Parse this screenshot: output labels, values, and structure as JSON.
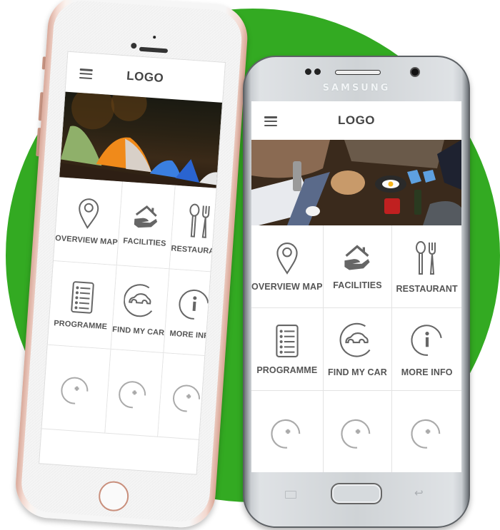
{
  "scene": {
    "background_color": "#ffffff",
    "accent_circle_color": "#33aa22"
  },
  "iphone": {
    "device": "iPhone (rose gold)",
    "app": {
      "header": {
        "logo": "LOGO",
        "menu_icon": "hamburger-menu-icon"
      },
      "hero_image": "camping-tents-at-night",
      "tiles": [
        {
          "label": "OVERVIEW MAP",
          "icon": "map-pin-icon"
        },
        {
          "label": "FACILITIES",
          "icon": "house-hand-icon"
        },
        {
          "label": "RESTAURANT",
          "icon": "spoon-fork-icon"
        },
        {
          "label": "PROGRAMME",
          "icon": "list-document-icon"
        },
        {
          "label": "FIND MY CAR",
          "icon": "car-circle-icon"
        },
        {
          "label": "MORE INFO",
          "icon": "info-circle-icon"
        },
        {
          "label": "",
          "icon": "add-circle-icon"
        },
        {
          "label": "",
          "icon": "add-circle-icon"
        },
        {
          "label": "",
          "icon": "add-circle-icon"
        }
      ]
    }
  },
  "samsung": {
    "device": "Samsung Galaxy (silver)",
    "brand": "SAMSUNG",
    "app": {
      "header": {
        "logo": "LOGO",
        "menu_icon": "hamburger-menu-icon"
      },
      "hero_image": "picnic-campfire-breakfast",
      "tiles": [
        {
          "label": "OVERVIEW MAP",
          "icon": "map-pin-icon"
        },
        {
          "label": "FACILITIES",
          "icon": "house-hand-icon"
        },
        {
          "label": "RESTAURANT",
          "icon": "spoon-fork-icon"
        },
        {
          "label": "PROGRAMME",
          "icon": "list-document-icon"
        },
        {
          "label": "FIND MY CAR",
          "icon": "car-circle-icon"
        },
        {
          "label": "MORE INFO",
          "icon": "info-circle-icon"
        },
        {
          "label": "",
          "icon": "add-circle-icon"
        },
        {
          "label": "",
          "icon": "add-circle-icon"
        },
        {
          "label": "",
          "icon": "add-circle-icon"
        }
      ]
    }
  }
}
